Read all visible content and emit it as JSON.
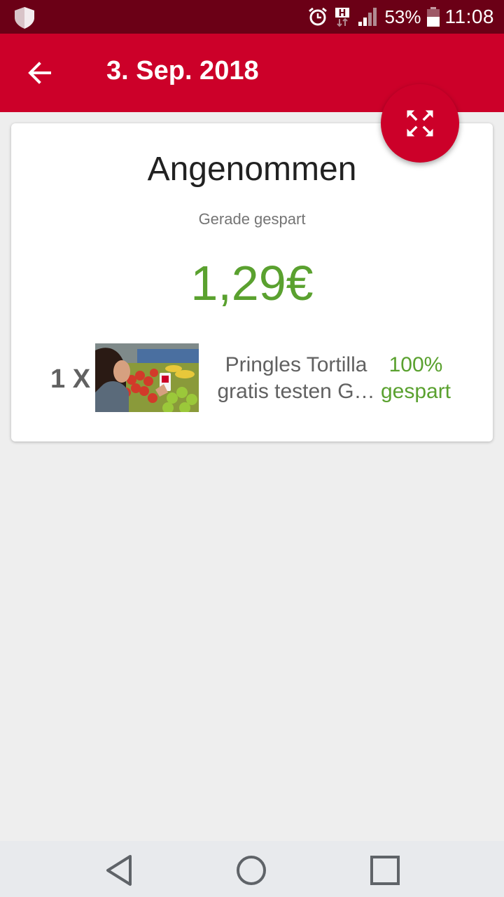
{
  "status_bar": {
    "battery_percent": "53%",
    "time": "11:08",
    "icons": [
      "shield-icon",
      "alarm-icon",
      "data-h-icon",
      "signal-icon",
      "battery-icon"
    ]
  },
  "app_bar": {
    "title": "3. Sep. 2018",
    "back_icon": "arrow-back-icon"
  },
  "fab": {
    "icon": "fullscreen-icon"
  },
  "card": {
    "title": "Angenommen",
    "subtitle": "Gerade gespart",
    "amount": "1,29€",
    "item": {
      "quantity": "1 X",
      "name_line1": "Pringles Tortilla",
      "name_line2": "gratis testen G…",
      "saved_line1": "100%",
      "saved_line2": "gespart"
    }
  },
  "nav_bar": {
    "icons": [
      "back-triangle-icon",
      "home-circle-icon",
      "recents-square-icon"
    ]
  },
  "colors": {
    "primary": "#cc0029",
    "primary_dark": "#6b0016",
    "accent_green": "#5aa12f"
  }
}
